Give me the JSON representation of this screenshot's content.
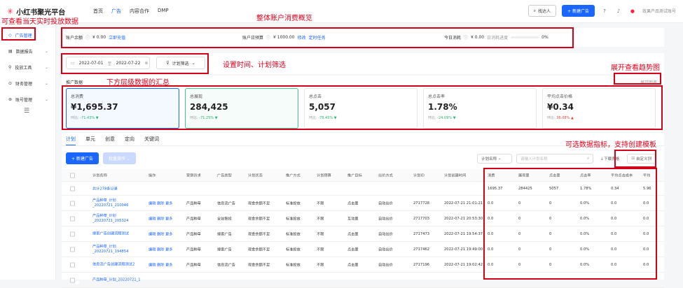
{
  "brand": {
    "name": "小红书聚光平台"
  },
  "topnav": [
    "首页",
    "广告",
    "内容合作",
    "DMP"
  ],
  "topright": {
    "find": "找达人",
    "new_ad": "+ 新建广告",
    "account": "效果产品测试账号"
  },
  "sidebar": [
    {
      "label": "广告管理",
      "active": true
    },
    {
      "label": "数据报告"
    },
    {
      "label": "投放工具"
    },
    {
      "label": "财务管理"
    },
    {
      "label": "账号管理"
    }
  ],
  "account_bar": {
    "balance_label": "账户余额",
    "balance": "¥ 0.00",
    "recharge": "立即充值",
    "budget_label": "账户日预算",
    "budget": "¥ 1000.00",
    "edit": "修改",
    "timed": "定时任务",
    "today_label": "今日消耗",
    "today": "¥ 0.00",
    "progress_label": "日消耗进度",
    "progress": "0%"
  },
  "filter": {
    "start": "2022-07-01",
    "sep": "至",
    "end": "2022-07-22",
    "plan_filter": "计划筛选"
  },
  "cards_section": {
    "title": "推广数据",
    "chart_link": "展开图表"
  },
  "cards": [
    {
      "label": "总消费",
      "value": "¥1,695.37",
      "cmp": "环比:",
      "change": "-71.43%",
      "dir": "down"
    },
    {
      "label": "总展现",
      "value": "284,425",
      "cmp": "环比:",
      "change": "-71.25%",
      "dir": "down"
    },
    {
      "label": "总点击",
      "value": "5,057",
      "cmp": "环比:",
      "change": "-78.45%",
      "dir": "down"
    },
    {
      "label": "总点击率",
      "value": "1.78%",
      "cmp": "环比:",
      "change": "-24.09%",
      "dir": "down"
    },
    {
      "label": "平均点击价格",
      "value": "¥0.34",
      "cmp": "环比:",
      "change": "36.08%",
      "dir": "up"
    }
  ],
  "tabs": [
    "计划",
    "单元",
    "创意",
    "定向",
    "关键词"
  ],
  "table_toolbar": {
    "new_ad": "+ 新建广告",
    "batch": "批量操作",
    "plan_name": "计划名称",
    "search_placeholder": "请输入计划名称",
    "download": "下载表格",
    "custom_cols": "自定义列"
  },
  "columns": [
    "计划名称",
    "操作",
    "营销诉求",
    "广告类型",
    "计划状态",
    "推广方式",
    "计划预算",
    "推广目标",
    "出价方式",
    "计划ID",
    "计划创建时间",
    "消费",
    "展现量",
    "点击量",
    "点击率",
    "平均点击成本",
    "平均"
  ],
  "total_row": {
    "name": "共计278条记录",
    "cost": "1695.37",
    "imp": "284425",
    "clk": "5057",
    "ctr": "1.78%",
    "cpc": "0.34",
    "last": "5.96"
  },
  "rows": [
    {
      "name": "产品种草_计划_20220721_210046",
      "ops": [
        "编辑",
        "删除",
        "更多"
      ],
      "goal": "产品种草",
      "type": "信息流广告",
      "status": "现金余额不足",
      "mode": "标准投放",
      "budget": "不限",
      "target": "点击量",
      "bid": "自动出价",
      "id": "2717728",
      "time": "2022-07-21 21:01:21",
      "cost": "0.0",
      "imp": "0",
      "clk": "0",
      "ctr": "0.0%",
      "cpc": "0.0",
      "last": "0.0"
    },
    {
      "name": "产品种草_计划_20220721_205324",
      "ops": [
        "编辑",
        "删除",
        "更多"
      ],
      "goal": "产品种草",
      "type": "全站智投",
      "status": "现金余额不足",
      "mode": "标准投放",
      "budget": "不限",
      "target": "互动量",
      "bid": "自动出价",
      "id": "2717703",
      "time": "2022-07-21 20:53:30",
      "cost": "0.0",
      "imp": "0",
      "clk": "0",
      "ctr": "0.0%",
      "cpc": "0.0",
      "last": "0.0"
    },
    {
      "name": "搜索广告创建流程测试",
      "ops": [
        "编辑",
        "删除",
        "更多"
      ],
      "goal": "产品种草",
      "type": "搜索广告",
      "status": "现金余额不足",
      "mode": "标准投放",
      "budget": "不限",
      "target": "点击量",
      "bid": "自动出价",
      "id": "2717473",
      "time": "2022-07-21 19:54:37",
      "cost": "0.0",
      "imp": "0",
      "clk": "0",
      "ctr": "0.0%",
      "cpc": "0.0",
      "last": "0.0"
    },
    {
      "name": "产品种草_计划_20220721_194854",
      "ops": [
        "编辑",
        "删除",
        "更多"
      ],
      "goal": "产品种草",
      "type": "搜索广告",
      "status": "现金余额不足",
      "mode": "标准投放",
      "budget": "不限",
      "target": "点击量",
      "bid": "自动出价",
      "id": "2717462",
      "time": "2022-07-21 19:49:00",
      "cost": "0.0",
      "imp": "0",
      "clk": "0",
      "ctr": "0.0%",
      "cpc": "0.0",
      "last": "0.0"
    },
    {
      "name": "信息流广告创建流程测试2",
      "ops": [
        "编辑",
        "删除",
        "更多"
      ],
      "goal": "产品种草",
      "type": "信息流广告",
      "status": "现金余额不足",
      "mode": "标准投放",
      "budget": "不限",
      "target": "点击量",
      "bid": "自动出价",
      "id": "2717196",
      "time": "2022-07-21 19:02:42",
      "cost": "0.0",
      "imp": "0",
      "clk": "0",
      "ctr": "0.0%",
      "cpc": "0.0",
      "last": "0.0"
    },
    {
      "name": "产品种草_计划_20220721_1",
      "ops": [],
      "goal": "",
      "type": "",
      "status": "",
      "mode": "",
      "budget": "",
      "target": "",
      "bid": "",
      "id": "",
      "time": "",
      "cost": "",
      "imp": "",
      "clk": "",
      "ctr": "",
      "cpc": "",
      "last": ""
    }
  ],
  "annotations": {
    "a1": "可查看当天实时投放数据",
    "a2": "整体账户消费概览",
    "a3": "设置时间、计划筛选",
    "a4": "展开查看趋势图",
    "a5": "下方层级数据的汇总",
    "a6": "可选数据指标，支持创建模板"
  }
}
